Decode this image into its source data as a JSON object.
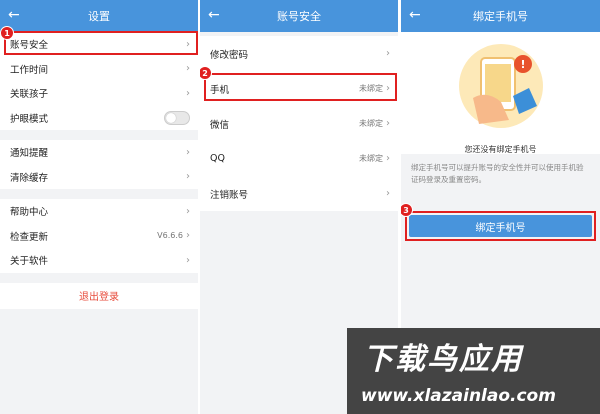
{
  "panel1": {
    "title": "设置",
    "group1": [
      {
        "label": "账号安全"
      },
      {
        "label": "工作时间"
      },
      {
        "label": "关联孩子"
      },
      {
        "label": "护眼模式"
      }
    ],
    "group2": [
      {
        "label": "通知提醒"
      },
      {
        "label": "清除缓存"
      }
    ],
    "group3": [
      {
        "label": "帮助中心",
        "value": ""
      },
      {
        "label": "检查更新",
        "value": "V6.6.6"
      },
      {
        "label": "关于软件",
        "value": ""
      }
    ],
    "logout": "退出登录",
    "step": "1",
    "eye_mode_on": false
  },
  "panel2": {
    "title": "账号安全",
    "rows": [
      {
        "label": "修改密码",
        "value": ""
      },
      {
        "label": "手机",
        "value": "未绑定"
      },
      {
        "label": "微信",
        "value": "未绑定"
      },
      {
        "label": "QQ",
        "value": "未绑定"
      },
      {
        "label": "注销账号",
        "value": ""
      }
    ],
    "step": "2"
  },
  "panel3": {
    "title": "绑定手机号",
    "caption": "您还没有绑定手机号",
    "description": "绑定手机号可以提升账号的安全性并可以使用手机验证码登录及重置密码。",
    "button": "绑定手机号",
    "step": "3"
  },
  "watermark": {
    "title": "下载鸟应用",
    "url": "www.xlazainlao.com"
  },
  "colors": {
    "header": "#4894dc",
    "highlight": "#e02020",
    "logout": "#e74c3c"
  }
}
